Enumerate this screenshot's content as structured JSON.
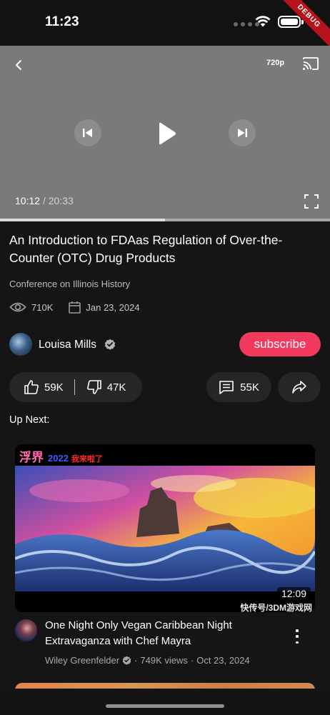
{
  "status_bar": {
    "time": "11:23",
    "debug_label": "DEBUG"
  },
  "player": {
    "quality": "720p",
    "current_time": "10:12",
    "separator": "/",
    "total_time": "20:33",
    "progress": 0.5
  },
  "video": {
    "title": "An Introduction to FDAas Regulation of Over-the-Counter (OTC) Drug Products",
    "subtitle": "Conference on Illinois History",
    "views": "710K",
    "date": "Jan 23, 2024"
  },
  "channel": {
    "name": "Louisa Mills",
    "subscribe_label": "subscribe"
  },
  "actions": {
    "likes": "59K",
    "dislikes": "47K",
    "comments": "55K"
  },
  "up_next": {
    "heading": "Up Next:",
    "items": [
      {
        "thumb_banner": "浮界",
        "thumb_year": "2022",
        "thumb_banner_tail": "我来啦了",
        "duration": "12:09",
        "watermark": "快传号/3DM游戏网",
        "title": "One Night Only Vegan Caribbean Night Extravaganza with Chef Mayra",
        "channel": "Wiley Greenfelder",
        "views": "749K views",
        "date": "Oct 23, 2024",
        "dot": "·"
      }
    ]
  },
  "colors": {
    "accent": "#f2395e",
    "player_bg": "#7a7a7a",
    "page_bg": "#151515",
    "pill_bg": "#262626"
  },
  "icons": {
    "back": "chevron-left-icon",
    "cast": "cast-icon",
    "prev": "skip-previous-icon",
    "play": "play-icon",
    "next": "skip-next-icon",
    "fullscreen": "fullscreen-icon",
    "views": "eye-icon",
    "date": "calendar-icon",
    "verified": "verified-badge-icon",
    "like": "thumb-up-icon",
    "dislike": "thumb-down-icon",
    "comments": "comment-icon",
    "share": "share-icon",
    "more": "more-vertical-icon"
  }
}
